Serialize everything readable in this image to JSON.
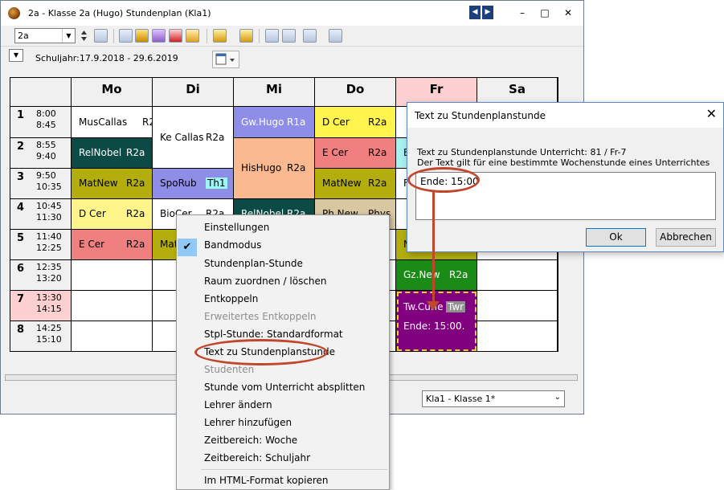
{
  "window": {
    "title": "2a - Klasse 2a (Hugo)  Stundenplan  (Kla1)",
    "minimize": "–",
    "maximize": "□",
    "close": "✕",
    "nav_prev": "◀",
    "nav_next": "▶"
  },
  "toolbar": {
    "class_combo_value": "2a",
    "combo_arrow": "▼"
  },
  "info": {
    "dropdown_arrow": "▼",
    "schuljahr": "Schuljahr:17.9.2018 - 29.6.2019"
  },
  "days": [
    "Mo",
    "Di",
    "Mi",
    "Do",
    "Fr",
    "Sa"
  ],
  "periods": [
    {
      "num": "1",
      "start": "8:00",
      "end": "8:45"
    },
    {
      "num": "2",
      "start": "8:55",
      "end": "9:40"
    },
    {
      "num": "3",
      "start": "9:50",
      "end": "10:35"
    },
    {
      "num": "4",
      "start": "10:45",
      "end": "11:30"
    },
    {
      "num": "5",
      "start": "11:40",
      "end": "12:25"
    },
    {
      "num": "6",
      "start": "12:35",
      "end": "13:20"
    },
    {
      "num": "7",
      "start": "13:30",
      "end": "14:15"
    },
    {
      "num": "8",
      "start": "14:25",
      "end": "15:10"
    }
  ],
  "lessons": {
    "mo1": {
      "a": "MusCallas",
      "b": "R2a"
    },
    "mo2": {
      "a": "RelNobel",
      "b": "R2a"
    },
    "mo3": {
      "a": "MatNew",
      "b": "R2a"
    },
    "mo4": {
      "a": "D  Cer",
      "b": "R2a"
    },
    "mo5": {
      "a": "E  Cer",
      "b": "R2a"
    },
    "di12": {
      "a": "Ke Callas",
      "b": "R2a"
    },
    "di3": {
      "a": "SpoRub",
      "b": "Th1"
    },
    "di4": {
      "a": "BioCer",
      "b": "R2a"
    },
    "di5": {
      "a": "Mat",
      "b": ""
    },
    "mi1": {
      "a": "Gw.Hugo",
      "b": "R1a"
    },
    "mi23": {
      "a": "HisHugo",
      "b": "R2a"
    },
    "mi4": {
      "a": "RelNobel",
      "b": "R2a"
    },
    "do1": {
      "a": "D  Cer",
      "b": "R2a"
    },
    "do2": {
      "a": "E  Cer",
      "b": "R2a"
    },
    "do3": {
      "a": "MatNew",
      "b": "R2a"
    },
    "do4": {
      "a": "Ph.New",
      "b": "Phys"
    },
    "fr2": {
      "a": "E",
      "b": ""
    },
    "fr3": {
      "a": "F",
      "b": ""
    },
    "fr5": {
      "a": "M",
      "b": ""
    },
    "fr6": {
      "a": "Gz.New",
      "b": "R2a"
    },
    "fr78": {
      "a": "Tw.Curie",
      "b": "Twr",
      "note": "Ende: 15:00."
    }
  },
  "class_select": {
    "value": "Kla1 - Klasse 1*",
    "arrow": "⌄"
  },
  "dialog": {
    "title": "Text zu Stundenplanstunde",
    "close": "✕",
    "line1": "Text zu Stundenplanstunde  Unterricht: 81 / Fr-7",
    "line2": "Der Text gilt für eine bestimmte Wochenstunde eines Unterrichtes",
    "text_value": "Ende: 15:00",
    "ok": "Ok",
    "cancel": "Abbrechen"
  },
  "context_menu": {
    "check": "✔",
    "items": [
      {
        "label": "Einstellungen",
        "disabled": false
      },
      {
        "label": "Bandmodus",
        "disabled": false
      },
      {
        "label": "Stundenplan-Stunde",
        "disabled": false
      },
      {
        "label": "Raum zuordnen / löschen",
        "disabled": false
      },
      {
        "label": "Entkoppeln",
        "disabled": false
      },
      {
        "label": "Erweitertes Entkoppeln",
        "disabled": true
      },
      {
        "label": "Stpl-Stunde: Standardformat",
        "disabled": false
      },
      {
        "label": "Text zu Stundenplanstunde",
        "disabled": false
      },
      {
        "label": "Studenten",
        "disabled": true
      },
      {
        "label": "Stunde vom Unterricht absplitten",
        "disabled": false
      },
      {
        "label": "Lehrer ändern",
        "disabled": false
      },
      {
        "label": "Lehrer hinzufügen",
        "disabled": false
      },
      {
        "label": "Zeitbereich: Woche",
        "disabled": false
      },
      {
        "label": "Zeitbereich: Schuljahr",
        "disabled": false
      },
      {
        "label": "Im HTML-Format kopieren",
        "disabled": false
      }
    ]
  },
  "colors": {
    "header_fr": "#fcd0d0",
    "row7_hdr": "#fcd0d0",
    "white": "#ffffff",
    "darkgreen": "#0b4a45",
    "olive": "#b3ad0e",
    "yellow": "#fff58a",
    "salmon": "#f08080",
    "lavender": "#8e8ee8",
    "orange": "#fbb98f",
    "yellow2": "#fff34d",
    "green": "#1a8b17",
    "purple": "#800080",
    "cyan": "#a9f0f0"
  }
}
